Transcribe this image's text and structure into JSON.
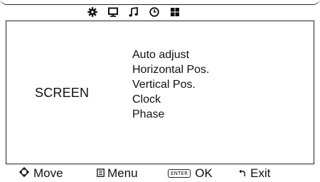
{
  "tabs": [
    {
      "icon": "gear-icon",
      "active": true
    },
    {
      "icon": "monitor-icon",
      "active": false
    },
    {
      "icon": "music-note-icon",
      "active": false
    },
    {
      "icon": "clock-icon",
      "active": false
    },
    {
      "icon": "windows-grid-icon",
      "active": false
    }
  ],
  "section": {
    "title": "SCREEN"
  },
  "menu": {
    "items": [
      "Auto adjust",
      "Horizontal Pos.",
      "Vertical Pos.",
      "Clock",
      "Phase"
    ]
  },
  "footer": {
    "move_label": "Move",
    "menu_label": "Menu",
    "enter_key": "ENTER",
    "ok_label": "OK",
    "exit_label": "Exit"
  }
}
